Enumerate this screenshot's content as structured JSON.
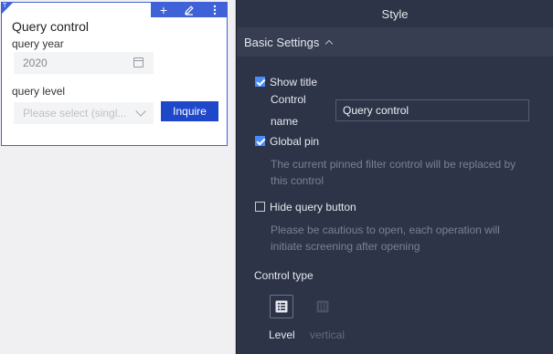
{
  "canvas": {
    "widget": {
      "title": "Query control",
      "year_label": "query year",
      "year_value": "2020",
      "level_label": "query level",
      "level_placeholder": "Please select (singl...",
      "inquire_label": "Inquire",
      "toolbar_icons": [
        "plus-icon",
        "pencil-icon",
        "more-vertical-icon"
      ]
    }
  },
  "panel": {
    "header": "Style",
    "section": "Basic Settings",
    "show_title": {
      "label": "Show title",
      "checked": true
    },
    "control_name": {
      "label_line1": "Control",
      "label_line2": "name",
      "value": "Query control"
    },
    "global_pin": {
      "label": "Global pin",
      "checked": true,
      "help_line1": "The current pinned filter control will be replaced by",
      "help_line2": "this control"
    },
    "hide_query_button": {
      "label": "Hide query button",
      "checked": false,
      "help_line1": "Please be cautious to open, each operation will",
      "help_line2": "initiate screening after opening"
    },
    "control_type": {
      "label": "Control type",
      "options": [
        {
          "label": "Level",
          "icon": "level-list-icon",
          "selected": true
        },
        {
          "label": "vertical",
          "icon": "vertical-layout-icon",
          "selected": false
        }
      ]
    }
  },
  "colors": {
    "accent": "#1f47c9",
    "selection_border": "#3f62d9",
    "panel_bg": "#2d3447",
    "checkbox_checked": "#4a8cf7"
  }
}
